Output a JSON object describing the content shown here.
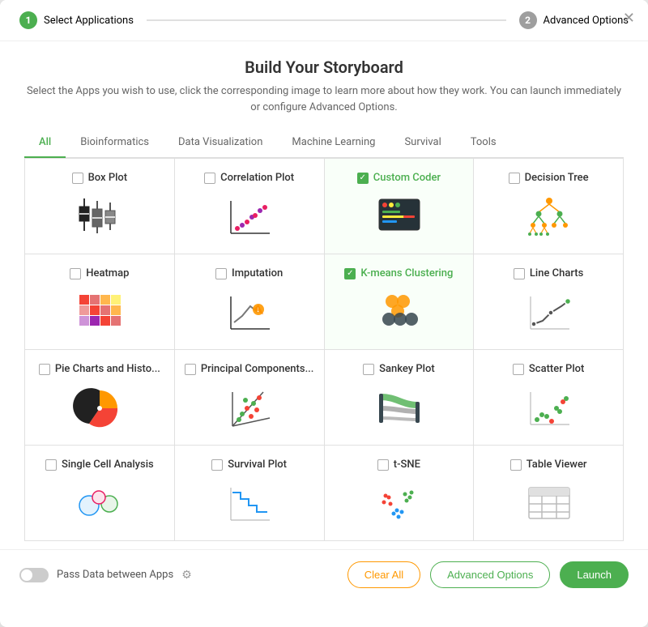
{
  "modal": {
    "close_label": "✕"
  },
  "wizard": {
    "step1_number": "1",
    "step1_label": "Select Applications",
    "step2_number": "2",
    "step2_label": "Advanced Options"
  },
  "header": {
    "title": "Build Your Storyboard",
    "subtitle": "Select the Apps you wish to use, click the corresponding image to learn more about how they work. You can launch immediately or configure Advanced Options."
  },
  "tabs": [
    {
      "label": "All",
      "active": true
    },
    {
      "label": "Bioinformatics",
      "active": false
    },
    {
      "label": "Data Visualization",
      "active": false
    },
    {
      "label": "Machine Learning",
      "active": false
    },
    {
      "label": "Survival",
      "active": false
    },
    {
      "label": "Tools",
      "active": false
    }
  ],
  "apps": [
    {
      "id": "box-plot",
      "label": "Box Plot",
      "checked": false
    },
    {
      "id": "correlation-plot",
      "label": "Correlation Plot",
      "checked": false
    },
    {
      "id": "custom-coder",
      "label": "Custom Coder",
      "checked": true
    },
    {
      "id": "decision-tree",
      "label": "Decision Tree",
      "checked": false
    },
    {
      "id": "heatmap",
      "label": "Heatmap",
      "checked": false
    },
    {
      "id": "imputation",
      "label": "Imputation",
      "checked": false
    },
    {
      "id": "kmeans",
      "label": "K-means Clustering",
      "checked": true
    },
    {
      "id": "line-charts",
      "label": "Line Charts",
      "checked": false
    },
    {
      "id": "pie-charts",
      "label": "Pie Charts and Histo...",
      "checked": false
    },
    {
      "id": "principal-components",
      "label": "Principal Components...",
      "checked": false
    },
    {
      "id": "sankey-plot",
      "label": "Sankey Plot",
      "checked": false
    },
    {
      "id": "scatter-plot",
      "label": "Scatter Plot",
      "checked": false
    },
    {
      "id": "single-cell",
      "label": "Single Cell Analysis",
      "checked": false
    },
    {
      "id": "survival-plot",
      "label": "Survival Plot",
      "checked": false
    },
    {
      "id": "tsne",
      "label": "t-SNE",
      "checked": false
    },
    {
      "id": "table-viewer",
      "label": "Table Viewer",
      "checked": false
    }
  ],
  "footer": {
    "pass_data_label": "Pass Data between Apps",
    "clear_all_label": "Clear All",
    "advanced_options_label": "Advanced Options",
    "launch_label": "Launch"
  }
}
